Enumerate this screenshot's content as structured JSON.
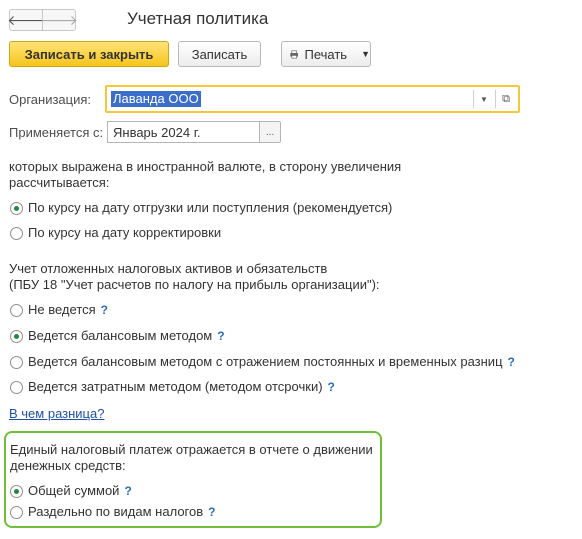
{
  "window": {
    "title": "Учетная политика"
  },
  "nav": {
    "back_glyph": "🡐",
    "forward_glyph": "🡒"
  },
  "toolbar": {
    "save_close_label": "Записать и закрыть",
    "save_label": "Записать",
    "print_label": "Печать"
  },
  "form": {
    "org_label": "Организация:",
    "org_value": "Лаванда ООО",
    "period_label": "Применяется с:",
    "period_value": "Январь 2024 г.",
    "period_btn": "..."
  },
  "currency_section": {
    "line1": "которых выражена в иностранной валюте, в сторону увеличения",
    "line2": "рассчитывается:",
    "options": [
      {
        "label": "По курсу на дату отгрузки или поступления (рекомендуется)",
        "selected": true
      },
      {
        "label": "По курсу на дату корректировки",
        "selected": false
      }
    ]
  },
  "deferred_section": {
    "line1": "Учет отложенных налоговых активов и обязательств",
    "line2": "(ПБУ 18 \"Учет расчетов по налогу на прибыль организации\"):",
    "options": [
      {
        "label": "Не ведется",
        "help": "?",
        "selected": false
      },
      {
        "label": "Ведется балансовым методом",
        "help": "?",
        "selected": true
      },
      {
        "label": "Ведется балансовым методом с отражением постоянных и временных разниц",
        "help": "?",
        "selected": false
      },
      {
        "label": "Ведется затратным методом (методом отсрочки)",
        "help": "?",
        "selected": false
      }
    ],
    "diff_link": "В чем разница?"
  },
  "tax_payment_section": {
    "line1": "Единый налоговый платеж отражается в отчете о движении",
    "line2": "денежных средств:",
    "options": [
      {
        "label": "Общей суммой",
        "help": "?",
        "selected": true
      },
      {
        "label": "Раздельно по видам налогов",
        "help": "?",
        "selected": false
      }
    ]
  },
  "colors": {
    "primary_button": "#f5c51c",
    "highlight_box": "#6fbf3a",
    "radio_selected": "#1e8a3c",
    "link": "#1f4fa8"
  }
}
